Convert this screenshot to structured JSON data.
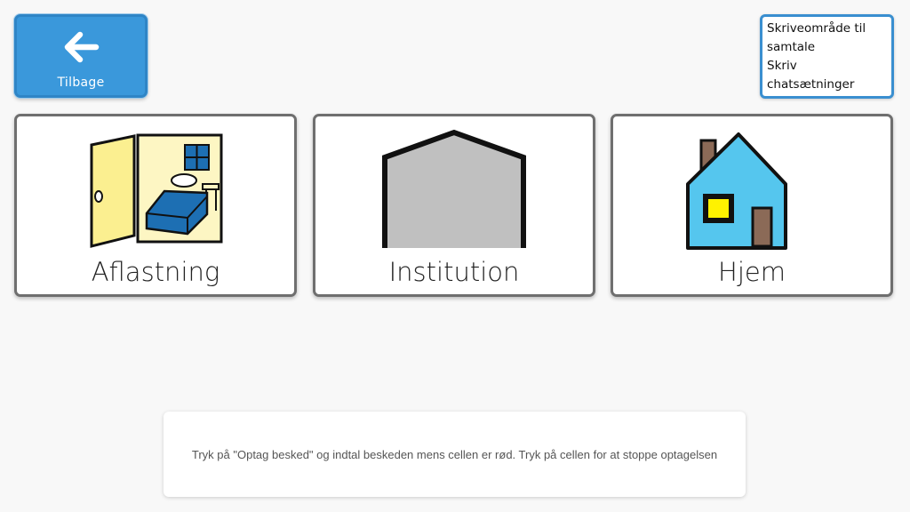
{
  "back_button": {
    "label": "Tilbage",
    "icon": "arrow-left-icon",
    "color": "#3a98db"
  },
  "write_area": {
    "lines": [
      "Skriveområde til",
      "samtale",
      "Skriv",
      "chatsætninger"
    ],
    "border_color": "#3a8fd0"
  },
  "tiles": [
    {
      "label": "Aflastning",
      "icon": "bedroom-icon"
    },
    {
      "label": "Institution",
      "icon": "building-icon"
    },
    {
      "label": "Hjem",
      "icon": "house-icon"
    }
  ],
  "hint": {
    "text": "Tryk på \"Optag besked\" og indtal beskeden mens cellen er rød. Tryk på cellen for at stoppe optagelsen"
  }
}
